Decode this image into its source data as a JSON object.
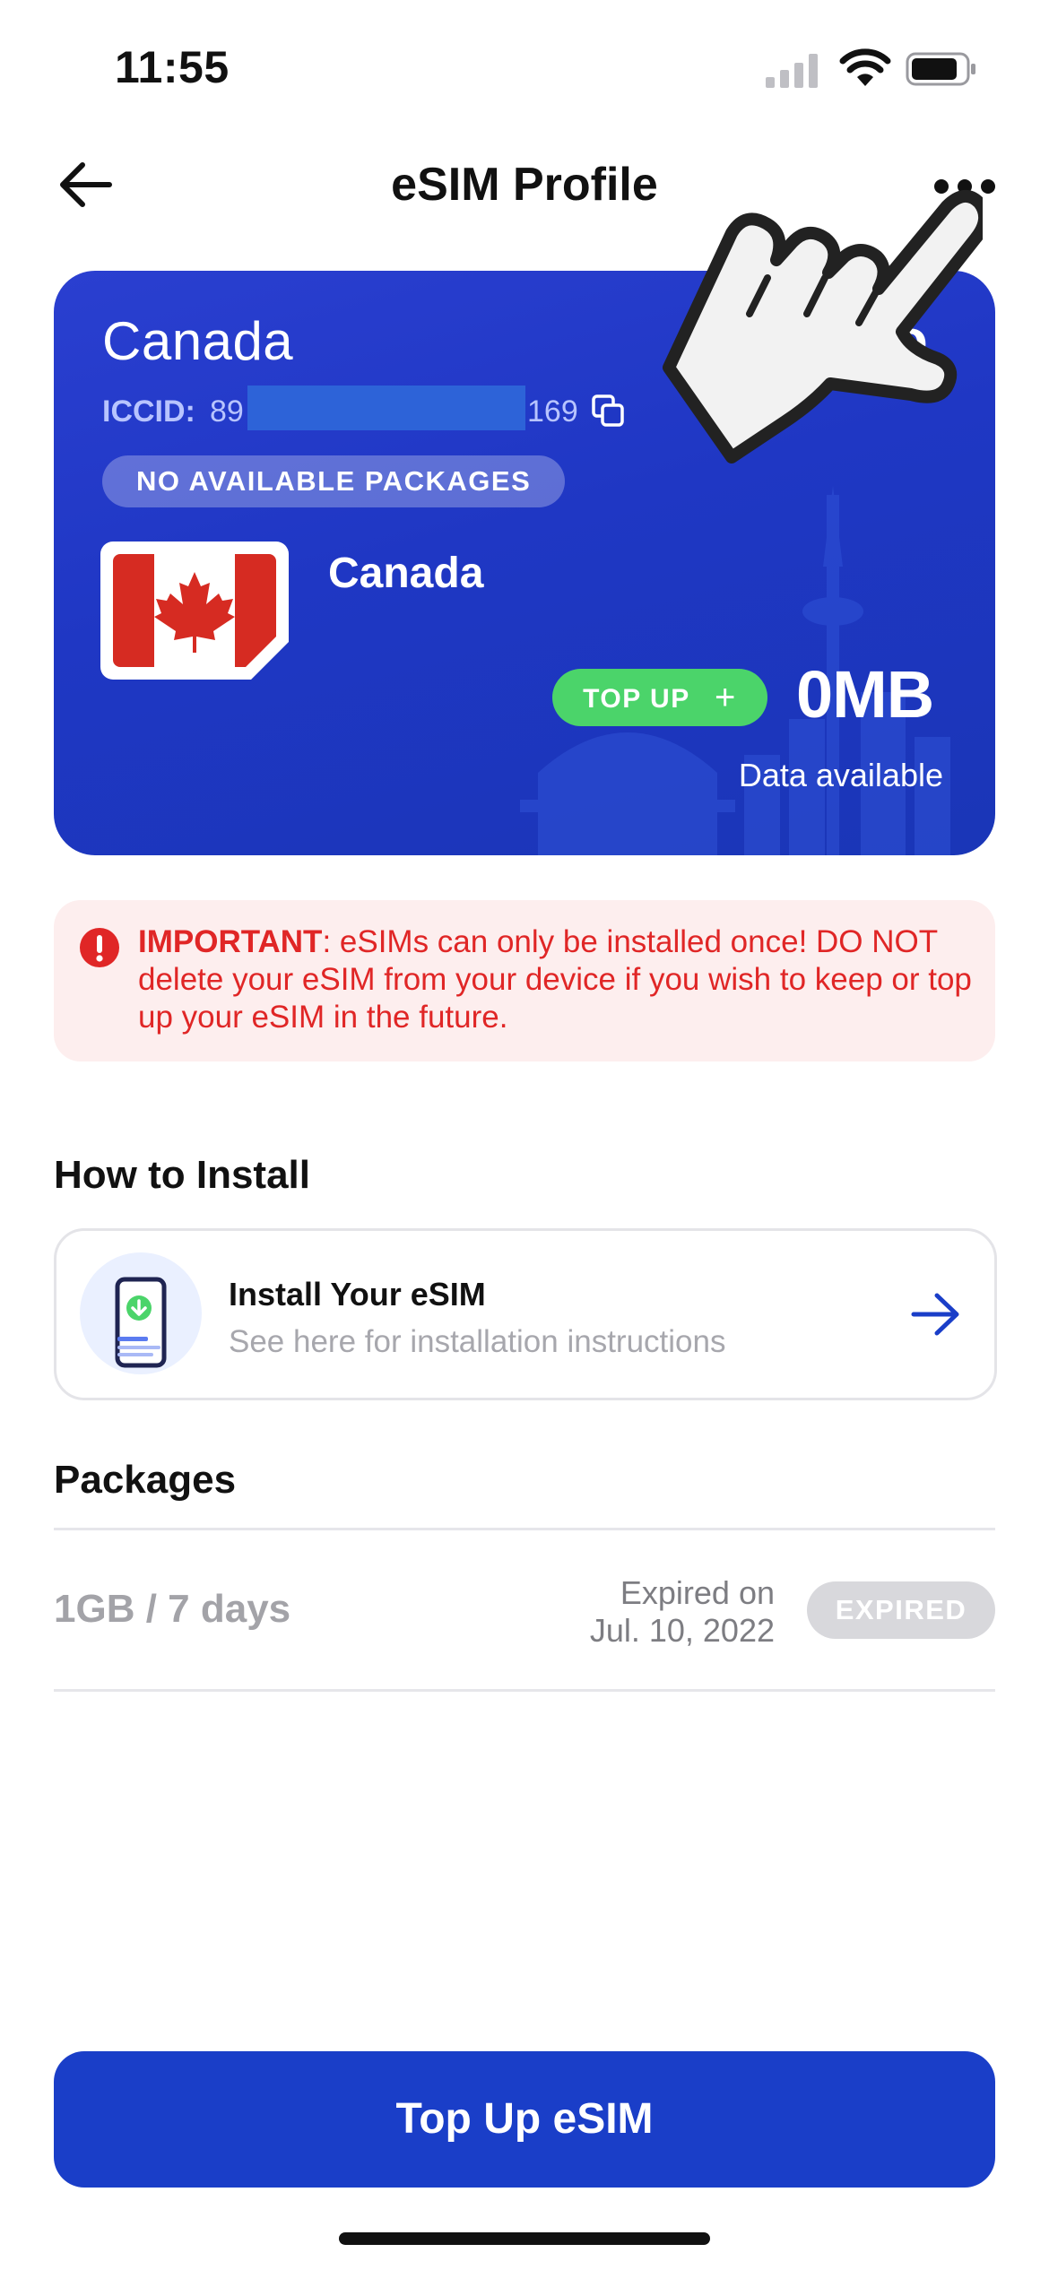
{
  "status_bar": {
    "time": "11:55"
  },
  "header": {
    "title": "eSIM Profile"
  },
  "card": {
    "country": "Canada",
    "iccid_label": "ICCID:",
    "iccid_start": "89",
    "iccid_end": "169",
    "badge": "NO AVAILABLE PACKAGES",
    "plan_name": "Canada",
    "topup_label": "TOP UP",
    "data_value": "0MB",
    "data_label": "Data available",
    "partial_corner_text": "lo"
  },
  "warning": {
    "bold": "IMPORTANT",
    "text": ": eSIMs can only be installed once! DO NOT delete your eSIM from your device if you wish to keep or top up your eSIM in the future."
  },
  "install": {
    "heading": "How to Install",
    "title": "Install Your eSIM",
    "subtitle": "See here for installation instructions"
  },
  "packages": {
    "heading": "Packages",
    "items": [
      {
        "name": "1GB / 7 days",
        "expired_line1": "Expired on",
        "expired_line2": "Jul. 10, 2022",
        "status": "EXPIRED"
      }
    ]
  },
  "cta": {
    "label": "Top Up eSIM"
  },
  "colors": {
    "primary": "#1a3ec8",
    "success": "#4bd46a",
    "danger": "#e02626",
    "warning_bg": "#fdeeee"
  },
  "icons": [
    "back-arrow-icon",
    "more-icon",
    "copy-icon",
    "canada-flag-icon",
    "plus-icon",
    "alert-icon",
    "phone-download-icon",
    "arrow-right-icon",
    "pointing-hand-icon"
  ]
}
